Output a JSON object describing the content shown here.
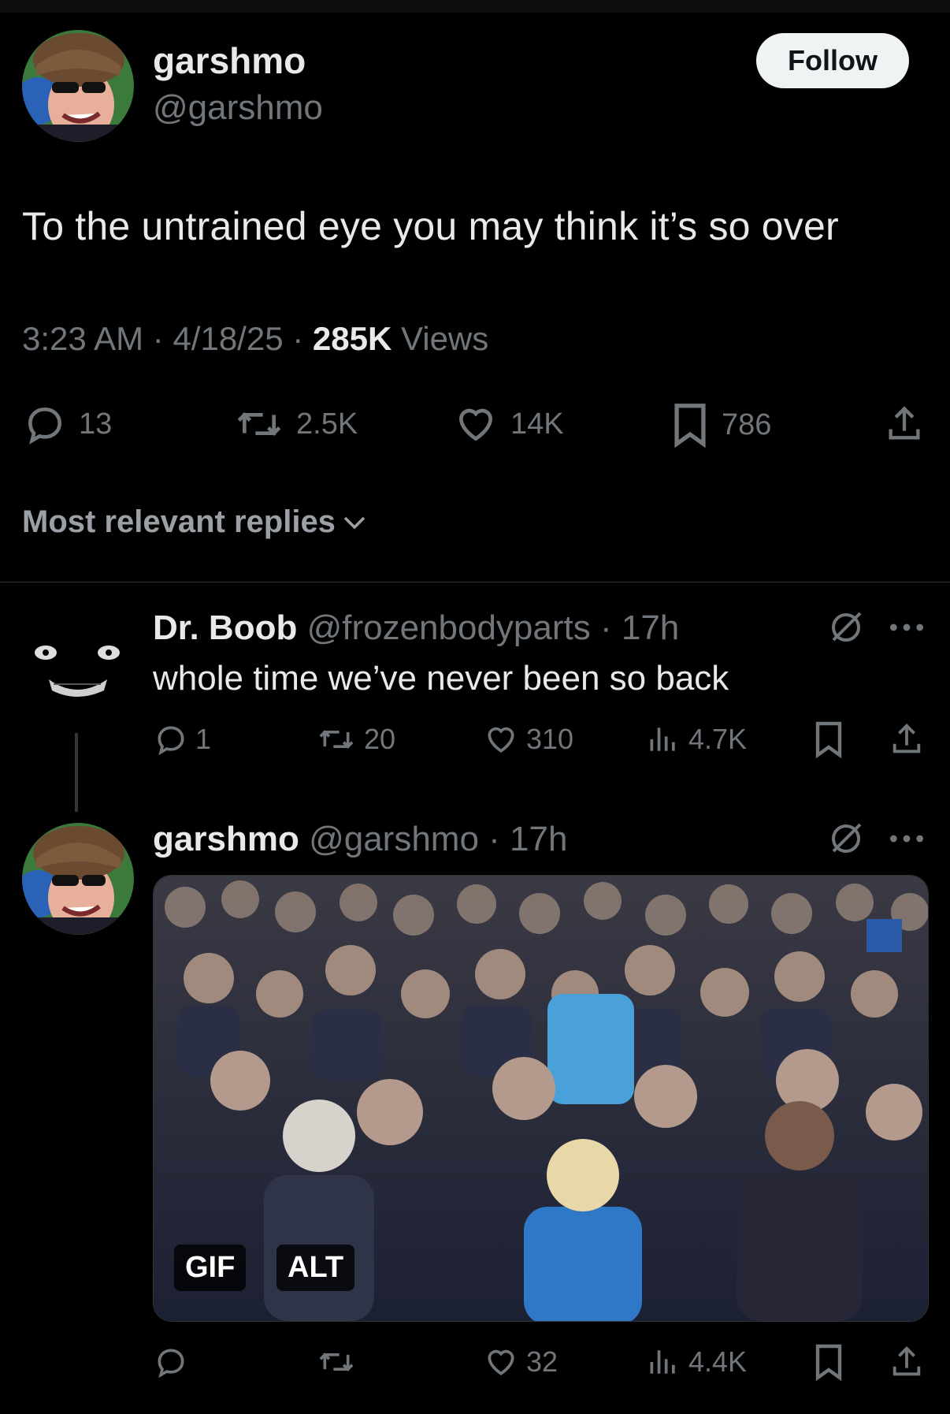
{
  "main_tweet": {
    "display_name": "garshmo",
    "handle": "@garshmo",
    "follow_label": "Follow",
    "text": "To the untrained eye you may think it’s so over",
    "time": "3:23 AM",
    "date": "4/18/25",
    "views_count": "285K",
    "views_label": "Views",
    "stats": {
      "replies": "13",
      "reposts": "2.5K",
      "likes": "14K",
      "bookmarks": "786"
    }
  },
  "replies_filter": {
    "label": "Most relevant replies"
  },
  "reply_1": {
    "display_name": "Dr. Boob",
    "handle": "@frozenbodyparts",
    "time": "· 17h",
    "text": "whole time we’ve never been so back",
    "stats": {
      "replies": "1",
      "reposts": "20",
      "likes": "310",
      "views": "4.7K"
    }
  },
  "reply_2": {
    "display_name": "garshmo",
    "handle": "@garshmo",
    "time": "· 17h",
    "media_badges": {
      "gif": "GIF",
      "alt": "ALT"
    },
    "stats": {
      "replies": "",
      "reposts": "",
      "likes": "32",
      "views": "4.4K"
    }
  },
  "colors": {
    "background": "#000000",
    "text_primary": "#e7e9ea",
    "text_muted": "#71767b",
    "follow_bg": "#eff3f4",
    "divider": "#2f3336"
  }
}
